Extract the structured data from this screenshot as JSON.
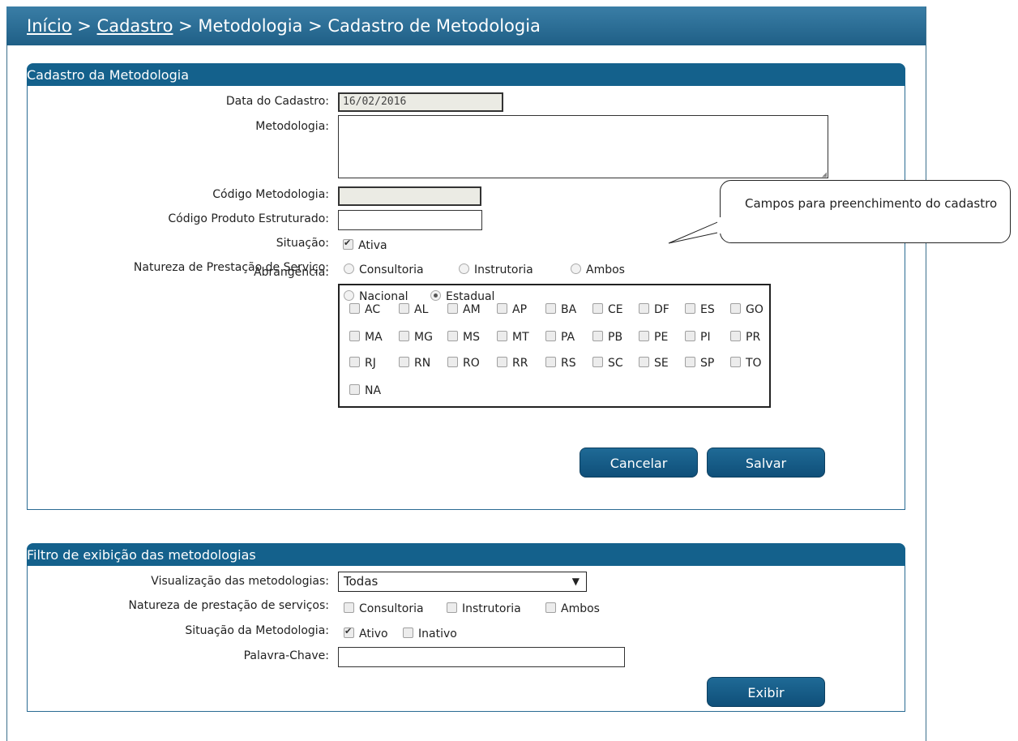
{
  "breadcrumb": {
    "home": "Início",
    "sep1": " > ",
    "cadastro": "Cadastro",
    "rest": " > Metodologia > Cadastro de Metodologia"
  },
  "cadastro": {
    "title": "Cadastro da Metodologia",
    "data_label": "Data do Cadastro:",
    "data_value": "16/02/2016",
    "metodologia_label": "Metodologia:",
    "codigo_label": "Código Metodologia:",
    "codigo_produto_label": "Código Produto Estruturado:",
    "situacao_label": "Situação:",
    "situacao_ativa": "Ativa",
    "natureza_label": "Natureza de Prestação de Serviço:",
    "natureza_options": [
      "Consultoria",
      "Instrutoria",
      "Ambos"
    ],
    "abrangencia_label": "Abrangência:",
    "abrangencia_options": [
      "Nacional",
      "Estadual"
    ],
    "abrangencia_selected": "Estadual",
    "ufs": [
      [
        "AC",
        "AL",
        "AM",
        "AP",
        "BA",
        "CE",
        "DF",
        "ES",
        "GO"
      ],
      [
        "MA",
        "MG",
        "MS",
        "MT",
        "PA",
        "PB",
        "PE",
        "PI",
        "PR"
      ],
      [
        "RJ",
        "RN",
        "RO",
        "RR",
        "RS",
        "SC",
        "SE",
        "SP",
        "TO"
      ],
      [
        "NA"
      ]
    ],
    "cancel_label": "Cancelar",
    "save_label": "Salvar"
  },
  "callout": {
    "text": "Campos para preenchimento do cadastro"
  },
  "filtro": {
    "title": "Filtro de exibição das metodologias",
    "visualizacao_label": "Visualização das metodologias:",
    "visualizacao_value": "Todas",
    "natureza_label": "Natureza de prestação de serviços:",
    "natureza_options": [
      "Consultoria",
      "Instrutoria",
      "Ambos"
    ],
    "situacao_label": "Situação da Metodologia:",
    "situacao_options": [
      "Ativo",
      "Inativo"
    ],
    "situacao_checked": "Ativo",
    "palavra_label": "Palavra-Chave:",
    "exibir_label": "Exibir"
  }
}
